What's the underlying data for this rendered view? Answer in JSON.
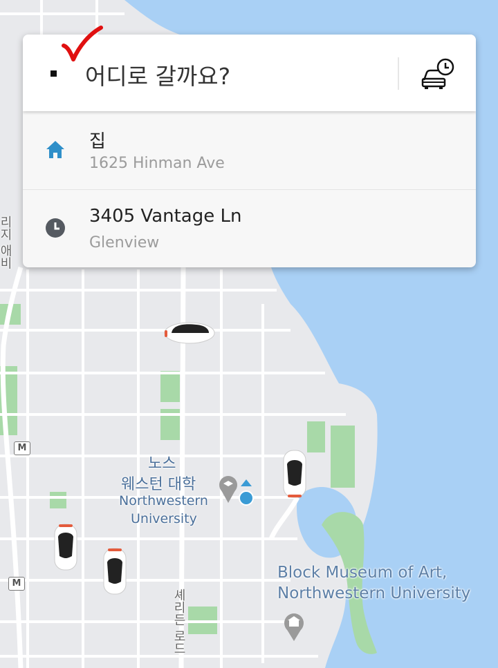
{
  "search": {
    "prompt": "어디로 갈까요?"
  },
  "saved_places": [
    {
      "title": "집",
      "subtitle": "1625 Hinman Ave",
      "icon": "home-icon"
    },
    {
      "title": "3405 Vantage Ln",
      "subtitle": "Glenview",
      "icon": "clock-icon"
    }
  ],
  "map": {
    "labels": {
      "university_ko_1": "노스",
      "university_ko_2": "웨스턴 대학",
      "university_en_1": "Northwestern",
      "university_en_2": "University",
      "museum_1": "Block Museum of Art,",
      "museum_2": "Northwestern University",
      "ridge_road": "리지 애비",
      "sheridan_road": "셰리든 로드",
      "metro_symbol": "M"
    }
  },
  "colors": {
    "water": "#a9d0f5",
    "land": "#e8e9ec",
    "park": "#a8d9a8",
    "accent_home": "#2f8fc9",
    "check": "#e01010"
  }
}
